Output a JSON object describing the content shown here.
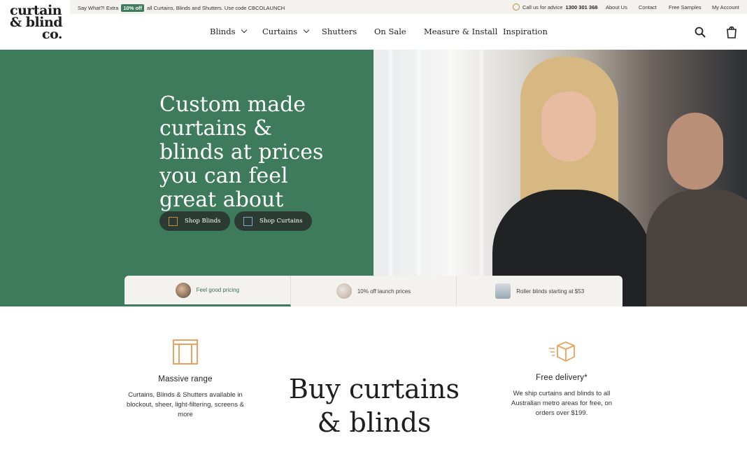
{
  "logo": {
    "line1": "curtain",
    "line2": "& blind",
    "line3": "co."
  },
  "topbar": {
    "promo_prefix": "Say What?! Extra",
    "promo_badge": "10% off",
    "promo_text": "all Curtains, Blinds and Shutters. Use code CBCOLAUNCH",
    "call_text": "Call us for advice",
    "phone": "1300 301 368",
    "links": [
      "About Us",
      "Contact",
      "Free Samples",
      "My Account"
    ]
  },
  "nav": {
    "items": [
      "Blinds",
      "Curtains",
      "Shutters",
      "On Sale",
      "Measure & Install",
      "Inspiration"
    ]
  },
  "hero": {
    "headline": "Custom made curtains & blinds at prices you can feel great about",
    "buttons": [
      "Shop Blinds",
      "Shop Curtains"
    ]
  },
  "features": [
    "Feel good pricing",
    "10% off launch prices",
    "Roller blinds starting at $53"
  ],
  "bottom": {
    "left": {
      "title": "Massive range",
      "text": "Curtains, Blinds & Shutters available in blockout, sheer, light-filtering, screens & more"
    },
    "center": {
      "heading": "Buy curtains & blinds"
    },
    "right": {
      "title": "Free delivery*",
      "text": "We ship curtains and blinds to all Australian metro areas for free, on orders over $199."
    }
  },
  "colors": {
    "brand_green": "#3d7b5c",
    "accent_orange": "#e9a25f",
    "topbar_bg": "#f4f2ee"
  }
}
